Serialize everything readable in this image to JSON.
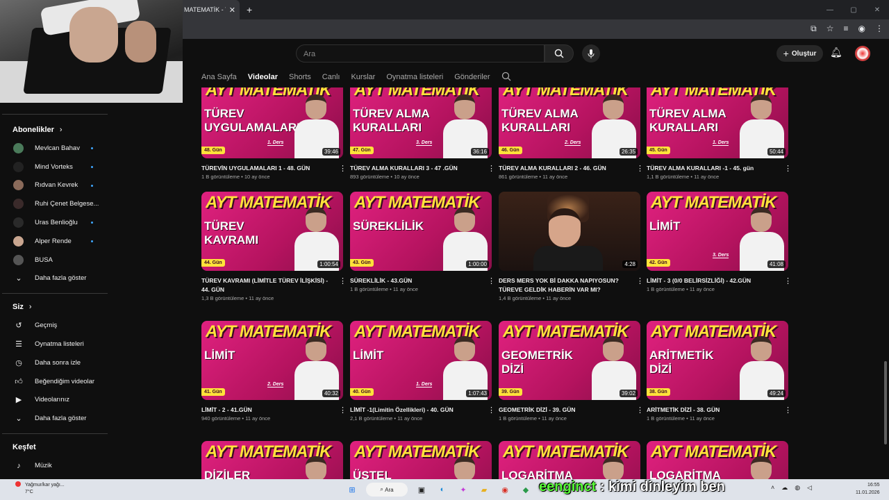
{
  "browser": {
    "tab_title": "MATEMATİK - Yo",
    "new_tab": "+",
    "close": "✕"
  },
  "header": {
    "search_placeholder": "Ara",
    "create_label": "Oluştur"
  },
  "channel_tabs": [
    "Ana Sayfa",
    "Videolar",
    "Shorts",
    "Canlı",
    "Kurslar",
    "Oynatma listeleri",
    "Gönderiler"
  ],
  "sidebar": {
    "subscriptions_title": "Abonelikler",
    "subscriptions": [
      {
        "label": "Mevlcan Bahav",
        "color": "#4a7a5a",
        "dot": true
      },
      {
        "label": "Mind Vorteks",
        "color": "#222222",
        "dot": true
      },
      {
        "label": "Rıdvan Kevrek",
        "color": "#8a6a5a",
        "dot": true
      },
      {
        "label": "Ruhi Çenet Belgese...",
        "color": "#3a2a2a",
        "dot": false
      },
      {
        "label": "Uras Benlioğlu",
        "color": "#2a2a2a",
        "dot": true
      },
      {
        "label": "Alper Rende",
        "color": "#c9a690",
        "dot": true
      },
      {
        "label": "BUSA",
        "color": "#555555",
        "dot": false
      }
    ],
    "show_more": "Daha fazla göster",
    "you_title": "Siz",
    "you_items": [
      {
        "label": "Geçmiş",
        "icon": "history-icon"
      },
      {
        "label": "Oynatma listeleri",
        "icon": "playlist-icon"
      },
      {
        "label": "Daha sonra izle",
        "icon": "clock-icon"
      },
      {
        "label": "Beğendiğim videolar",
        "icon": "thumbs-up-icon"
      },
      {
        "label": "Videolarınız",
        "icon": "video-icon"
      }
    ],
    "you_show_more": "Daha fazla göster",
    "explore_title": "Keşfet",
    "explore_items": [
      {
        "label": "Müzik",
        "icon": "music-icon"
      }
    ]
  },
  "videos": [
    {
      "ayt": "AYT MATEMATİK",
      "topic": "TÜREV UYGULAMALARI",
      "day": "48. Gün",
      "ders": "1. Ders",
      "duration": "39:46",
      "title": "TÜREVİN UYGULAMALARI 1 - 48. GÜN",
      "views": "1 B görüntüleme",
      "age": "10 ay önce"
    },
    {
      "ayt": "AYT MATEMATİK",
      "topic": "TÜREV ALMA KURALLARI",
      "day": "47. Gün",
      "ders": "3. Ders",
      "duration": "36:16",
      "title": "TÜREV ALMA KURALLARI 3 - 47 .GÜN",
      "views": "893 görüntüleme",
      "age": "10 ay önce"
    },
    {
      "ayt": "AYT MATEMATİK",
      "topic": "TÜREV ALMA KURALLARI",
      "day": "46. Gün",
      "ders": "2. Ders",
      "duration": "26:35",
      "title": "TÜREV ALMA KURALLARI 2 - 46. GÜN",
      "views": "861 görüntüleme",
      "age": "11 ay önce"
    },
    {
      "ayt": "AYT MATEMATİK",
      "topic": "TÜREV ALMA KURALLARI",
      "day": "45. Gün",
      "ders": "1. Ders",
      "duration": "50:44",
      "title": "TÜREV ALMA KURALLARI -1 - 45. gün",
      "views": "1,1 B görüntüleme",
      "age": "11 ay önce"
    },
    {
      "ayt": "AYT MATEMATİK",
      "topic": "TÜREV KAVRAMI",
      "day": "44. Gün",
      "ders": "",
      "duration": "1:00:54",
      "title": "TÜREV KAVRAMI (LİMİTLE TÜREV İLİŞKİSİ) - 44. GÜN",
      "views": "1,3 B görüntüleme",
      "age": "11 ay önce"
    },
    {
      "ayt": "AYT MATEMATİK",
      "topic": "SÜREKLİLİK",
      "day": "43. Gün",
      "ders": "",
      "duration": "1:00:00",
      "title": "SÜREKLİLİK - 43.GÜN",
      "views": "1 B görüntüleme",
      "age": "11 ay önce"
    },
    {
      "ayt": "",
      "topic": "",
      "day": "",
      "ders": "",
      "duration": "4:28",
      "title": "DERS MERS YOK Bİ DAKKA NAPIYOSUN? TÜREVE GELDİK HABERİN VAR MI?",
      "views": "1,4 B görüntüleme",
      "age": "11 ay önce",
      "photo": true
    },
    {
      "ayt": "AYT MATEMATİK",
      "topic": "LİMİT",
      "day": "42. Gün",
      "ders": "3. Ders",
      "duration": "41:08",
      "title": "LİMİT - 3 (0/0 BELİRSİZLİĞİ) - 42.GÜN",
      "views": "1 B görüntüleme",
      "age": "11 ay önce"
    },
    {
      "ayt": "AYT MATEMATİK",
      "topic": "LİMİT",
      "day": "41. Gün",
      "ders": "2. Ders",
      "duration": "40:32",
      "title": "LİMİT - 2 - 41.GÜN",
      "views": "940 görüntüleme",
      "age": "11 ay önce"
    },
    {
      "ayt": "AYT MATEMATİK",
      "topic": "LİMİT",
      "day": "40. Gün",
      "ders": "1. Ders",
      "duration": "1:07:43",
      "title": "LİMİT -1(Limitin Özellikleri) - 40. GÜN",
      "views": "2,1 B görüntüleme",
      "age": "11 ay önce"
    },
    {
      "ayt": "AYT MATEMATİK",
      "topic": "GEOMETRİK DİZİ",
      "day": "39. Gün",
      "ders": "",
      "duration": "39:02",
      "title": "GEOMETRİK DİZİ - 39. GÜN",
      "views": "1 B görüntüleme",
      "age": "11 ay önce"
    },
    {
      "ayt": "AYT MATEMATİK",
      "topic": "ARİTMETİK DİZİ",
      "day": "38. Gün",
      "ders": "",
      "duration": "49:24",
      "title": "ARİTMETİK DİZİ - 38. GÜN",
      "views": "1 B görüntüleme",
      "age": "11 ay önce"
    },
    {
      "ayt": "AYT MATEMATİK",
      "topic": "DİZİLER",
      "day": "",
      "ders": "",
      "duration": "",
      "title": "",
      "views": "",
      "age": ""
    },
    {
      "ayt": "AYT MATEMATİK",
      "topic": "ÜSTEL LOGARİTMİK",
      "day": "",
      "ders": "",
      "duration": "",
      "title": "",
      "views": "",
      "age": ""
    },
    {
      "ayt": "AYT MATEMATİK",
      "topic": "LOGARİTMA",
      "day": "",
      "ders": "",
      "duration": "",
      "title": "",
      "views": "",
      "age": ""
    },
    {
      "ayt": "AYT MATEMATİK",
      "topic": "LOGARİTMA",
      "day": "",
      "ders": "",
      "duration": "",
      "title": "",
      "views": "",
      "age": ""
    }
  ],
  "taskbar": {
    "weather_line1": "Yağmur/kar yağı...",
    "weather_line2": "7°C",
    "search_label": "Ara",
    "time": "16:55",
    "date": "11.01.2026"
  },
  "caption": {
    "nick": "eenginct",
    "text": ": kimi dinleyim ben"
  }
}
